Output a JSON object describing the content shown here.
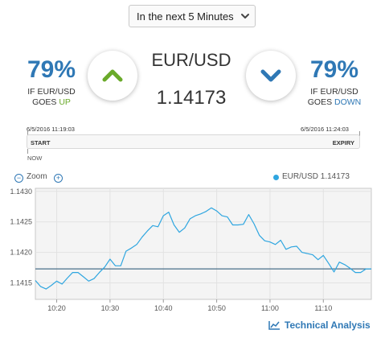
{
  "dropdown": {
    "selected": "In the next 5 Minutes"
  },
  "up": {
    "percent": "79%",
    "caption_line1": "IF EUR/USD",
    "caption_goes": "GOES",
    "caption_dir": "UP"
  },
  "down": {
    "percent": "79%",
    "caption_line1": "IF EUR/USD",
    "caption_goes": "GOES",
    "caption_dir": "DOWN"
  },
  "asset": {
    "pair": "EUR/USD",
    "price": "1.14173"
  },
  "timeline": {
    "start_time": "6/5/2016 11:19:03",
    "expiry_time": "6/5/2016 11:24:03",
    "start_label": "START",
    "expiry_label": "EXPIRY",
    "now_label": "NOW"
  },
  "zoom": {
    "label": "Zoom",
    "minus": "−",
    "plus": "+"
  },
  "legend": {
    "text": "EUR/USD 1.14173"
  },
  "colors": {
    "accent": "#2f78b5",
    "up_green": "#6aaa2a",
    "series": "#2fa6e0",
    "strike": "#4a6f8a",
    "plot_bg": "#f4f4f4"
  },
  "chart_data": {
    "type": "line",
    "title": "",
    "xlabel": "",
    "ylabel": "",
    "x_ticks": [
      "10:20",
      "10:30",
      "10:40",
      "10:50",
      "11:00",
      "11:10"
    ],
    "y_ticks": [
      "1.1415",
      "1.1420",
      "1.1425",
      "1.1430"
    ],
    "xlim": [
      "10:16",
      "11:19"
    ],
    "ylim": [
      1.14123,
      1.14305
    ],
    "grid": true,
    "legend_position": "top-right",
    "strike_level": 1.14173,
    "series": [
      {
        "name": "EUR/USD",
        "values": [
          [
            "10:16",
            1.14154
          ],
          [
            "10:17",
            1.14144
          ],
          [
            "10:18",
            1.1414
          ],
          [
            "10:19",
            1.14146
          ],
          [
            "10:20",
            1.14153
          ],
          [
            "10:21",
            1.14148
          ],
          [
            "10:22",
            1.14158
          ],
          [
            "10:23",
            1.14167
          ],
          [
            "10:24",
            1.14167
          ],
          [
            "10:25",
            1.1416
          ],
          [
            "10:26",
            1.14153
          ],
          [
            "10:27",
            1.14157
          ],
          [
            "10:28",
            1.14167
          ],
          [
            "10:29",
            1.14176
          ],
          [
            "10:30",
            1.14189
          ],
          [
            "10:31",
            1.14178
          ],
          [
            "10:32",
            1.14178
          ],
          [
            "10:33",
            1.14202
          ],
          [
            "10:34",
            1.14207
          ],
          [
            "10:35",
            1.14213
          ],
          [
            "10:36",
            1.14225
          ],
          [
            "10:37",
            1.14235
          ],
          [
            "10:38",
            1.14244
          ],
          [
            "10:39",
            1.14242
          ],
          [
            "10:40",
            1.1426
          ],
          [
            "10:41",
            1.14266
          ],
          [
            "10:42",
            1.14245
          ],
          [
            "10:43",
            1.14233
          ],
          [
            "10:44",
            1.1424
          ],
          [
            "10:45",
            1.14255
          ],
          [
            "10:46",
            1.1426
          ],
          [
            "10:47",
            1.14263
          ],
          [
            "10:48",
            1.14267
          ],
          [
            "10:49",
            1.14273
          ],
          [
            "10:50",
            1.14268
          ],
          [
            "10:51",
            1.1426
          ],
          [
            "10:52",
            1.14258
          ],
          [
            "10:53",
            1.14245
          ],
          [
            "10:54",
            1.14245
          ],
          [
            "10:55",
            1.14246
          ],
          [
            "10:56",
            1.14262
          ],
          [
            "10:57",
            1.14247
          ],
          [
            "10:58",
            1.14228
          ],
          [
            "10:59",
            1.14219
          ],
          [
            "11:00",
            1.14217
          ],
          [
            "11:01",
            1.14213
          ],
          [
            "11:02",
            1.1422
          ],
          [
            "11:03",
            1.14205
          ],
          [
            "11:04",
            1.14209
          ],
          [
            "11:05",
            1.1421
          ],
          [
            "11:06",
            1.142
          ],
          [
            "11:07",
            1.14198
          ],
          [
            "11:08",
            1.14196
          ],
          [
            "11:09",
            1.14188
          ],
          [
            "11:10",
            1.14195
          ],
          [
            "11:11",
            1.14182
          ],
          [
            "11:12",
            1.14168
          ],
          [
            "11:13",
            1.14184
          ],
          [
            "11:14",
            1.1418
          ],
          [
            "11:15",
            1.14174
          ],
          [
            "11:16",
            1.14167
          ],
          [
            "11:17",
            1.14167
          ],
          [
            "11:18",
            1.14173
          ],
          [
            "11:19",
            1.14173
          ]
        ]
      }
    ]
  },
  "footer": {
    "technical_analysis": "Technical Analysis"
  }
}
